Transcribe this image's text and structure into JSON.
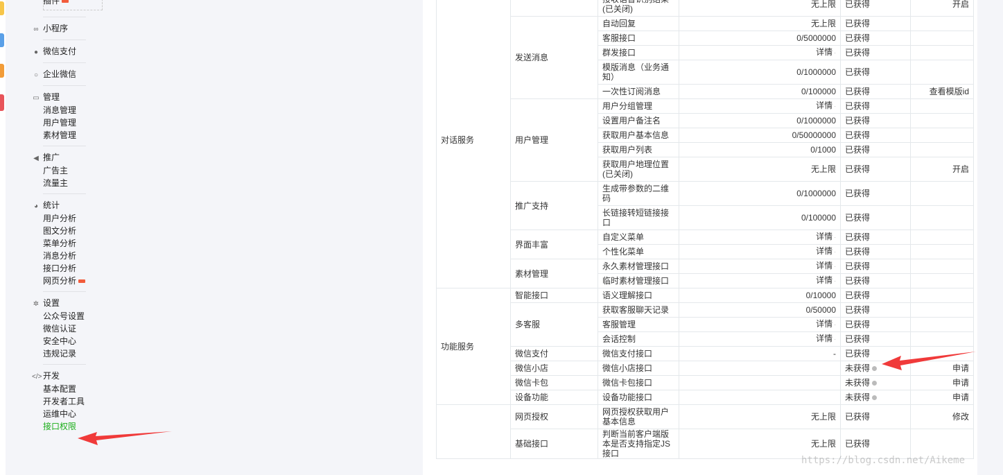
{
  "sidebar": {
    "plugin_label": "插件",
    "groups": [
      {
        "title": "小程序",
        "icon": "link-icon",
        "items": []
      },
      {
        "title": "微信支付",
        "icon": "wechat-pay-icon",
        "items": []
      },
      {
        "title": "企业微信",
        "icon": "chat-bubble-icon",
        "items": []
      },
      {
        "title": "管理",
        "icon": "inbox-icon",
        "items": [
          "消息管理",
          "用户管理",
          "素材管理"
        ]
      },
      {
        "title": "推广",
        "icon": "megaphone-icon",
        "items": [
          "广告主",
          "流量主"
        ]
      },
      {
        "title": "统计",
        "icon": "pie-chart-icon",
        "items": [
          "用户分析",
          "图文分析",
          "菜单分析",
          "消息分析",
          "接口分析",
          "网页分析"
        ]
      },
      {
        "title": "设置",
        "icon": "gear-icon",
        "items": [
          "公众号设置",
          "微信认证",
          "安全中心",
          "违规记录"
        ]
      },
      {
        "title": "开发",
        "icon": "code-icon",
        "items": [
          "基本配置",
          "开发者工具",
          "运维中心",
          "接口权限"
        ]
      }
    ]
  },
  "table": {
    "sections": [
      {
        "category": "对话服务",
        "groups": [
          {
            "name": "",
            "rows": [
              {
                "name": "接收语音识别结果(已关闭)",
                "quota": "无上限",
                "status": "已获得",
                "op": "开启"
              }
            ]
          },
          {
            "name": "发送消息",
            "rows": [
              {
                "name": "自动回复",
                "quota": "无上限",
                "status": "已获得",
                "op": ""
              },
              {
                "name": "客服接口",
                "quota": "0/5000000",
                "status": "已获得",
                "op": ""
              },
              {
                "name": "群发接口",
                "quota": "详情",
                "status": "已获得",
                "op": ""
              },
              {
                "name": "模版消息（业务通知）",
                "quota": "0/1000000",
                "status": "已获得",
                "op": ""
              },
              {
                "name": "一次性订阅消息",
                "quota": "0/100000",
                "status": "已获得",
                "op": "查看模版id"
              }
            ]
          },
          {
            "name": "用户管理",
            "rows": [
              {
                "name": "用户分组管理",
                "quota": "详情",
                "status": "已获得",
                "op": ""
              },
              {
                "name": "设置用户备注名",
                "quota": "0/1000000",
                "status": "已获得",
                "op": ""
              },
              {
                "name": "获取用户基本信息",
                "quota": "0/50000000",
                "status": "已获得",
                "op": ""
              },
              {
                "name": "获取用户列表",
                "quota": "0/1000",
                "status": "已获得",
                "op": ""
              },
              {
                "name": "获取用户地理位置(已关闭)",
                "quota": "无上限",
                "status": "已获得",
                "op": "开启"
              }
            ]
          },
          {
            "name": "推广支持",
            "rows": [
              {
                "name": "生成带参数的二维码",
                "quota": "0/1000000",
                "status": "已获得",
                "op": ""
              },
              {
                "name": "长链接转短链接接口",
                "quota": "0/100000",
                "status": "已获得",
                "op": ""
              }
            ]
          },
          {
            "name": "界面丰富",
            "rows": [
              {
                "name": "自定义菜单",
                "quota": "详情",
                "status": "已获得",
                "op": ""
              },
              {
                "name": "个性化菜单",
                "quota": "详情",
                "status": "已获得",
                "op": ""
              }
            ]
          },
          {
            "name": "素材管理",
            "rows": [
              {
                "name": "永久素材管理接口",
                "quota": "详情",
                "status": "已获得",
                "op": ""
              },
              {
                "name": "临时素材管理接口",
                "quota": "详情",
                "status": "已获得",
                "op": ""
              }
            ]
          }
        ]
      },
      {
        "category": "功能服务",
        "groups": [
          {
            "name": "智能接口",
            "rows": [
              {
                "name": "语义理解接口",
                "quota": "0/10000",
                "status": "已获得",
                "op": ""
              }
            ]
          },
          {
            "name": "多客服",
            "rows": [
              {
                "name": "获取客服聊天记录",
                "quota": "0/50000",
                "status": "已获得",
                "op": ""
              },
              {
                "name": "客服管理",
                "quota": "详情",
                "status": "已获得",
                "op": ""
              },
              {
                "name": "会话控制",
                "quota": "详情",
                "status": "已获得",
                "op": ""
              }
            ]
          },
          {
            "name": "微信支付",
            "gray": true,
            "rows": [
              {
                "name": "微信支付接口",
                "quota": "-",
                "status": "已获得",
                "op": ""
              }
            ]
          },
          {
            "name": "微信小店",
            "gray": true,
            "rows": [
              {
                "name": "微信小店接口",
                "quota": "",
                "status": "未获得",
                "op": "申请"
              }
            ]
          },
          {
            "name": "微信卡包",
            "gray": true,
            "rows": [
              {
                "name": "微信卡包接口",
                "quota": "",
                "status": "未获得",
                "op": "申请"
              }
            ]
          },
          {
            "name": "设备功能",
            "gray": true,
            "rows": [
              {
                "name": "设备功能接口",
                "quota": "",
                "status": "未获得",
                "op": "申请"
              }
            ]
          }
        ]
      },
      {
        "category": "",
        "groups": [
          {
            "name": "网页授权",
            "rows": [
              {
                "name": "网页授权获取用户基本信息",
                "quota": "无上限",
                "status": "已获得",
                "op": "修改"
              }
            ]
          },
          {
            "name": "基础接口",
            "rows": [
              {
                "name": "判断当前客户端版本是否支持指定JS接口",
                "quota": "无上限",
                "status": "已获得",
                "op": ""
              }
            ]
          }
        ]
      }
    ]
  },
  "watermark": "https://blog.csdn.net/Aikeme",
  "colors": {
    "active": "#1aad19",
    "arrow": "#f03a3a",
    "newtag": "#f25c3c"
  }
}
